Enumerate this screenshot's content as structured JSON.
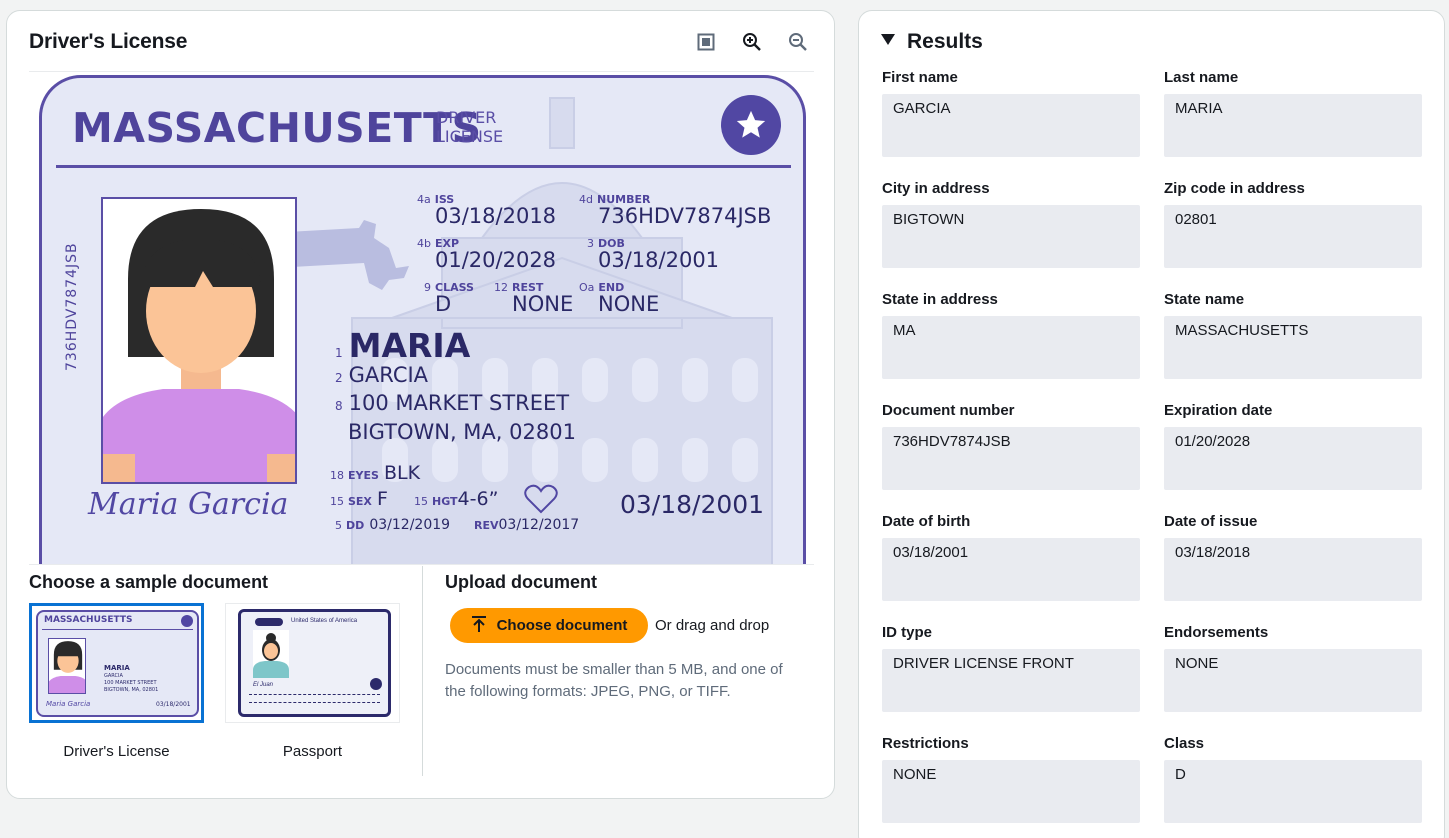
{
  "left_panel": {
    "title": "Driver's License",
    "tools": [
      "fit-icon",
      "zoom-in-icon",
      "zoom-out-icon"
    ]
  },
  "license": {
    "state": "MASSACHUSETTS",
    "doc_label_1": "DRIVER",
    "doc_label_2": "LICENSE",
    "vertical_number": "736HDV7874JSB",
    "iss_num": "4a",
    "iss_label": "ISS",
    "iss": "03/18/2018",
    "number_num": "4d",
    "number_label": "NUMBER",
    "number": "736HDV7874JSB",
    "exp_num": "4b",
    "exp_label": "EXP",
    "exp": "01/20/2028",
    "dob_num": "3",
    "dob_label": "DOB",
    "dob": "03/18/2001",
    "class_num": "9",
    "class_label": "CLASS",
    "class": "D",
    "rest_num": "12",
    "rest_label": "REST",
    "rest": "NONE",
    "end_num": "Oa",
    "end_label": "END",
    "end": "NONE",
    "n1": "1",
    "first": "MARIA",
    "n2": "2",
    "last": "GARCIA",
    "n8": "8",
    "street": "100 MARKET STREET",
    "city": "BIGTOWN, MA, 02801",
    "eyes_num": "18",
    "eyes_label": "EYES",
    "eyes": "BLK",
    "sex_num": "15",
    "sex_label": "SEX",
    "sex": "F",
    "hgt_num": "15",
    "hgt_label": "HGT",
    "hgt": "4-6”",
    "dd_num": "5",
    "dd_label": "DD",
    "dd": "03/12/2019",
    "rev_label": "REV",
    "rev": "03/12/2017",
    "dob_big": "03/18/2001",
    "signature": "Maria Garcia"
  },
  "samples": {
    "title": "Choose a sample document",
    "items": [
      {
        "label": "Driver's License",
        "selected": true
      },
      {
        "label": "Passport",
        "selected": false
      }
    ],
    "thumb_dl": {
      "state": "MASSACHUSETTS",
      "first": "MARIA",
      "last": "GARCIA",
      "street": "100 MARKET STREET",
      "city": "BIGTOWN, MA, 02801",
      "dob": "03/18/2001",
      "sig": "Maria Garcia"
    },
    "thumb_pp": {
      "country": "United States of America",
      "sig": "El Juan"
    }
  },
  "upload": {
    "title": "Upload document",
    "button": "Choose document",
    "drag": "Or drag and drop",
    "help": "Documents must be smaller than 5 MB, and one of the following formats: JPEG, PNG, or TIFF."
  },
  "results": {
    "title": "Results",
    "fields": [
      {
        "label": "First name",
        "value": "GARCIA"
      },
      {
        "label": "Last name",
        "value": "MARIA"
      },
      {
        "label": "City in address",
        "value": "BIGTOWN"
      },
      {
        "label": "Zip code in address",
        "value": "02801"
      },
      {
        "label": "State in address",
        "value": "MA"
      },
      {
        "label": "State name",
        "value": "MASSACHUSETTS"
      },
      {
        "label": "Document number",
        "value": "736HDV7874JSB"
      },
      {
        "label": "Expiration date",
        "value": "01/20/2028"
      },
      {
        "label": "Date of birth",
        "value": "03/18/2001"
      },
      {
        "label": "Date of issue",
        "value": "03/18/2018"
      },
      {
        "label": "ID type",
        "value": "DRIVER LICENSE FRONT"
      },
      {
        "label": "Endorsements",
        "value": "NONE"
      },
      {
        "label": "Restrictions",
        "value": "NONE"
      },
      {
        "label": "Class",
        "value": "D"
      }
    ]
  },
  "colors": {
    "accent": "#ff9900",
    "select": "#0972d3",
    "card_purple": "#5a4ea6",
    "card_bg": "#e5e8f6",
    "field_bg": "#e9ebf0"
  }
}
